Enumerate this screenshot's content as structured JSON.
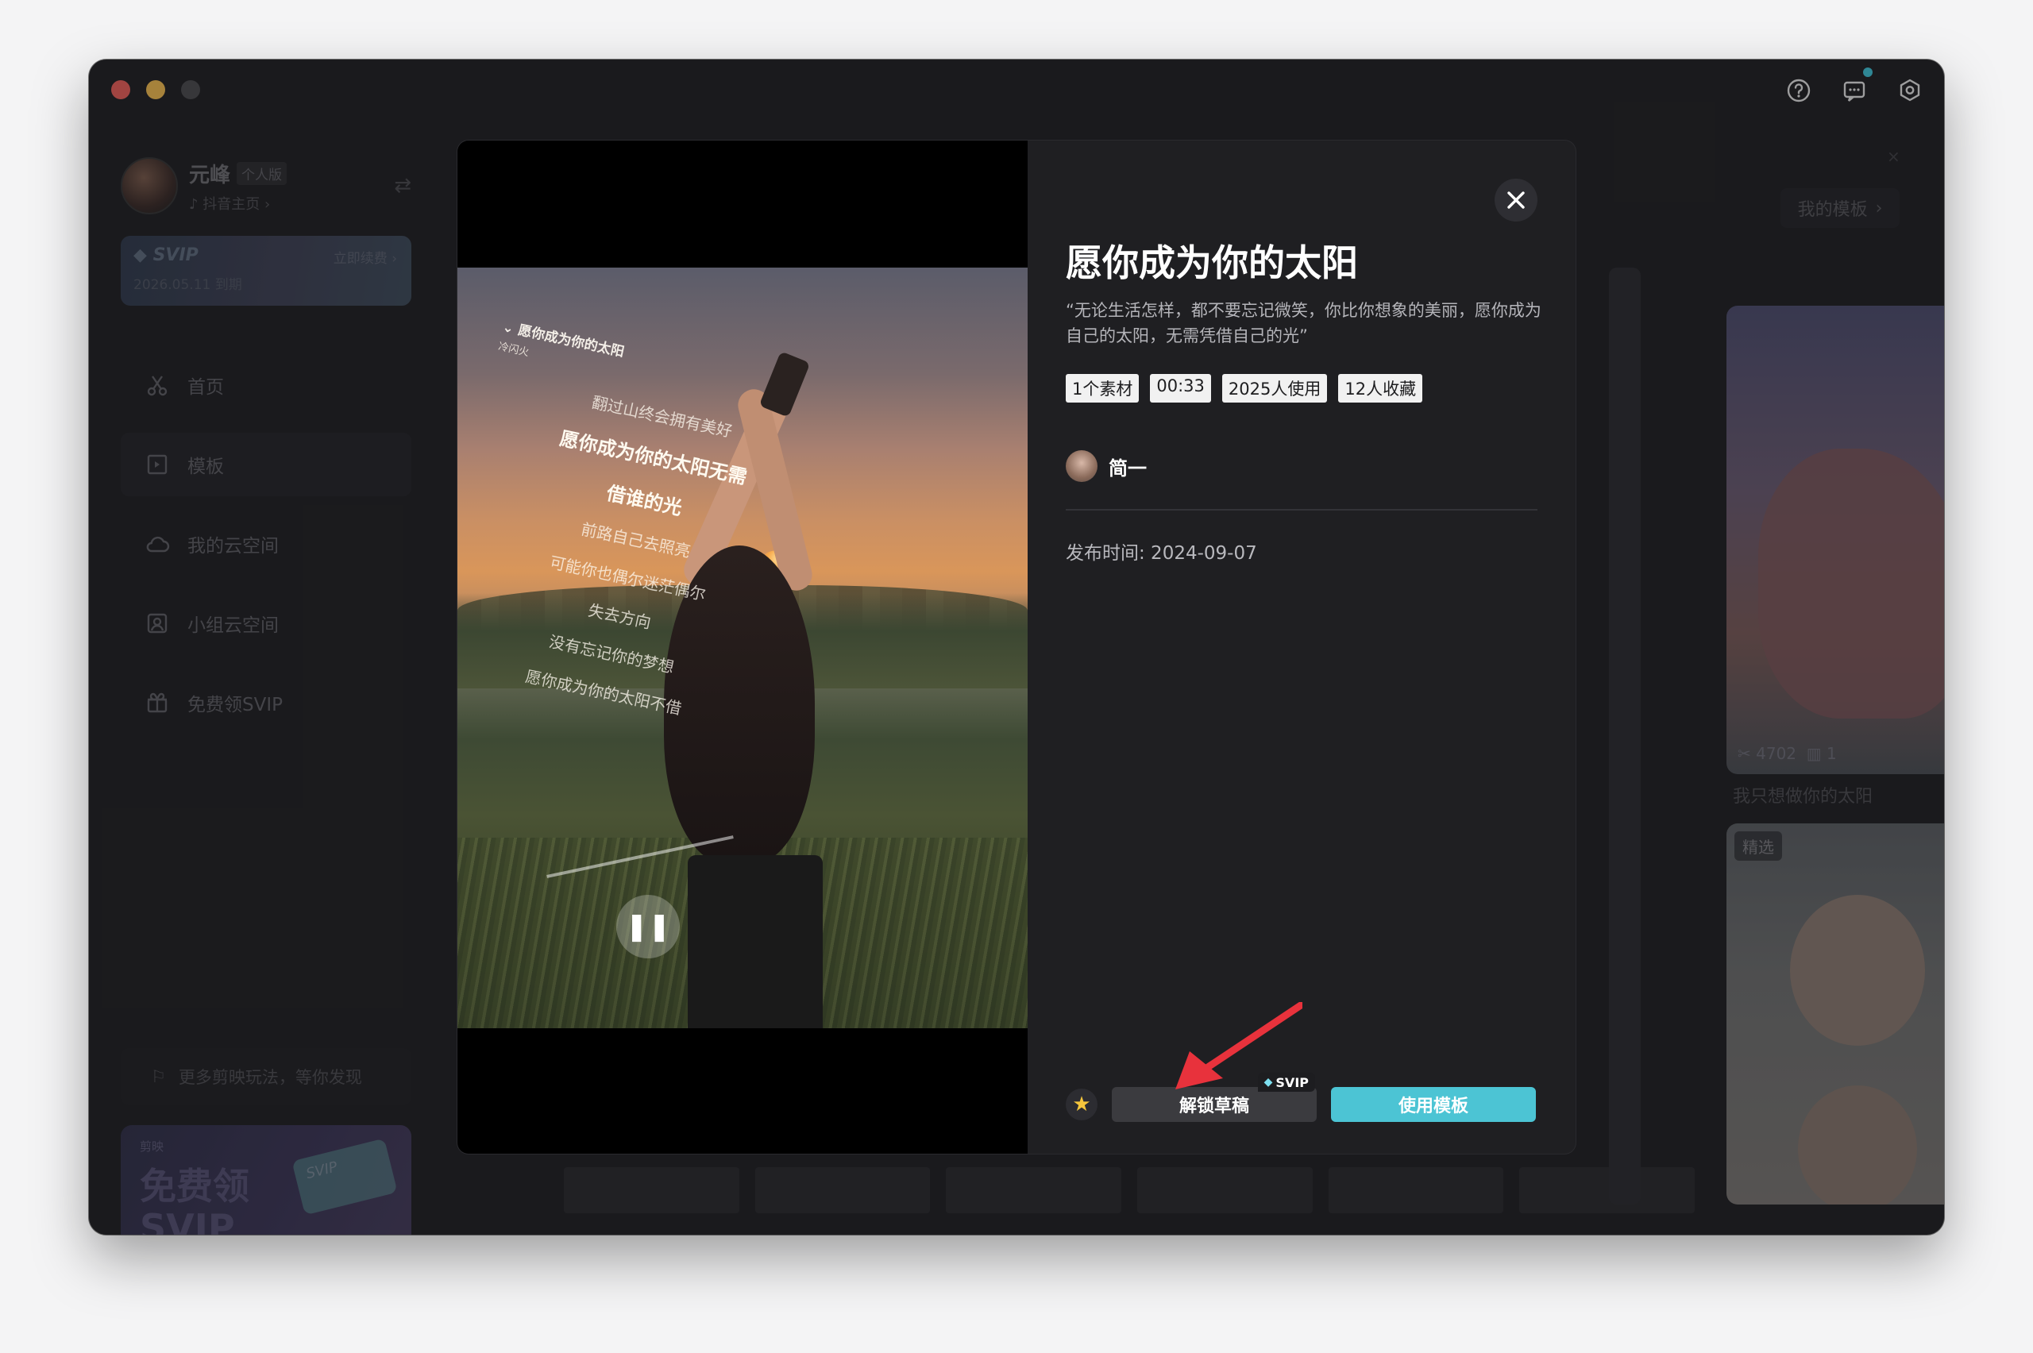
{
  "window": {
    "controls": [
      "close",
      "minimize",
      "maximize"
    ],
    "top_icons": [
      "help-icon",
      "feedback-icon",
      "settings-icon"
    ]
  },
  "sidebar": {
    "user": {
      "name": "元峰",
      "edition": "个人版",
      "douyin_link": "抖音主页 ›"
    },
    "svip": {
      "title": "SVIP",
      "renew": "立即续费 ›",
      "expire": "2026.05.11 到期"
    },
    "nav": [
      {
        "label": "首页",
        "icon": "scissors-icon"
      },
      {
        "label": "模板",
        "icon": "template-icon",
        "active": true
      },
      {
        "label": "我的云空间",
        "icon": "cloud-icon"
      },
      {
        "label": "小组云空间",
        "icon": "team-cloud-icon"
      },
      {
        "label": "免费领SVIP",
        "icon": "gift-icon"
      }
    ],
    "tip": "更多剪映玩法，等你发现",
    "promo": {
      "brand": "剪映",
      "title_line1": "免费领",
      "title_line2": "SVIP",
      "card_text": "SVIP"
    }
  },
  "background": {
    "my_template_label": "我的模板",
    "card1": {
      "stats_uses": "4702",
      "stats_materials": "1",
      "caption": "我只想做你的太阳"
    },
    "card2": {
      "tag": "精选"
    }
  },
  "modal": {
    "video": {
      "song_title": "愿你成为你的太阳",
      "artist": "冷闪火",
      "lyrics": [
        "翻过山终会拥有美好",
        "愿你成为你的太阳无需",
        "借谁的光",
        "前路自己去照亮",
        "可能你也偶尔迷茫偶尔",
        "失去方向",
        "没有忘记你的梦想",
        "愿你成为你的太阳不借"
      ],
      "highlight_index": 1
    },
    "title": "愿你成为你的太阳",
    "description": "“无论生活怎样，都不要忘记微笑，你比你想象的美丽，愿你成为自己的太阳，无需凭借自己的光”",
    "tags": [
      "1个素材",
      "00:33",
      "2025人使用",
      "12人收藏"
    ],
    "author": "简一",
    "publish_time": "发布时间: 2024-09-07",
    "buttons": {
      "unlock": "解锁草稿",
      "unlock_badge": "SVIP",
      "use": "使用模板"
    },
    "colors": {
      "accent": "#4cc4d4",
      "arrow": "#e8323c"
    }
  }
}
